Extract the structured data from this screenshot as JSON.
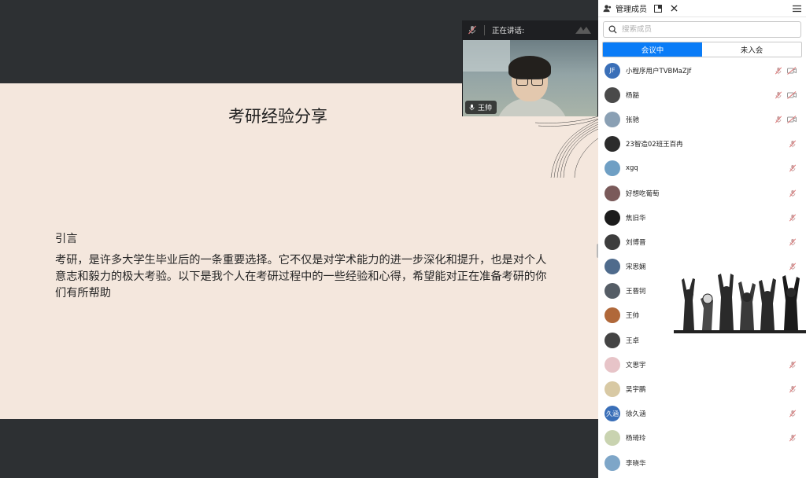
{
  "slide": {
    "title": "考研经验分享",
    "heading": "引言",
    "paragraph": "考研，是许多大学生毕业后的一条重要选择。它不仅是对学术能力的进一步深化和提升，也是对个人意志和毅力的极大考验。以下是我个人在考研过程中的一些经验和心得，希望能对正在准备考研的你们有所帮助"
  },
  "speaker": {
    "label": "正在讲话:",
    "name": "王帅",
    "icons": [
      "mic-muted-icon",
      "expand-icon",
      "mic-icon"
    ]
  },
  "panel": {
    "title": "管理成员",
    "search_placeholder": "搜索成员",
    "tabs": [
      {
        "label": "会议中",
        "active": true
      },
      {
        "label": "未入会",
        "active": false
      }
    ],
    "members": [
      {
        "name": "小程序用户TVBMaZJf",
        "avatar_text": "JF",
        "avatar_color": "#3a6fb8",
        "mic_muted": true,
        "video": true
      },
      {
        "name": "杨豁",
        "avatar_text": "",
        "avatar_color": "#4a4a4a",
        "mic_muted": true,
        "video": true
      },
      {
        "name": "张驰",
        "avatar_text": "",
        "avatar_color": "#8aa0b4",
        "mic_muted": true,
        "video": true
      },
      {
        "name": "23智造02班王百冉",
        "avatar_text": "",
        "avatar_color": "#2b2b2b",
        "mic_muted": true,
        "video": false
      },
      {
        "name": "xgq",
        "avatar_text": "",
        "avatar_color": "#6f9fc4",
        "mic_muted": true,
        "video": false
      },
      {
        "name": "好想吃葡萄",
        "avatar_text": "",
        "avatar_color": "#7a5a5a",
        "mic_muted": true,
        "video": false
      },
      {
        "name": "焦旧华",
        "avatar_text": "",
        "avatar_color": "#1c1c1c",
        "mic_muted": true,
        "video": false
      },
      {
        "name": "刘博晋",
        "avatar_text": "",
        "avatar_color": "#3d3d3d",
        "mic_muted": true,
        "video": false
      },
      {
        "name": "宋思娴",
        "avatar_text": "",
        "avatar_color": "#4f6b8c",
        "mic_muted": true,
        "video": false
      },
      {
        "name": "王晋钶",
        "avatar_text": "",
        "avatar_color": "#555d66",
        "mic_muted": true,
        "video": false
      },
      {
        "name": "王帅",
        "avatar_text": "",
        "avatar_color": "#b0683a",
        "mic_muted": false,
        "video": false
      },
      {
        "name": "王卓",
        "avatar_text": "",
        "avatar_color": "#444444",
        "mic_muted": false,
        "video": false
      },
      {
        "name": "文思宇",
        "avatar_text": "",
        "avatar_color": "#e7c4c8",
        "mic_muted": true,
        "video": false
      },
      {
        "name": "吴宇鹏",
        "avatar_text": "",
        "avatar_color": "#d8c9a4",
        "mic_muted": true,
        "video": false
      },
      {
        "name": "徐久涵",
        "avatar_text": "久涵",
        "avatar_color": "#3a6fb8",
        "mic_muted": true,
        "video": false
      },
      {
        "name": "杨琦玲",
        "avatar_text": "",
        "avatar_color": "#c9d3b0",
        "mic_muted": true,
        "video": false
      },
      {
        "name": "李晓华",
        "avatar_text": "",
        "avatar_color": "#7ea6c8",
        "mic_muted": false,
        "video": false
      }
    ]
  },
  "colors": {
    "accent": "#0a7cf7",
    "slide_bg": "#f4e7dd",
    "stage_bg": "#2d3033",
    "muted_icon": "#e07a7a"
  }
}
